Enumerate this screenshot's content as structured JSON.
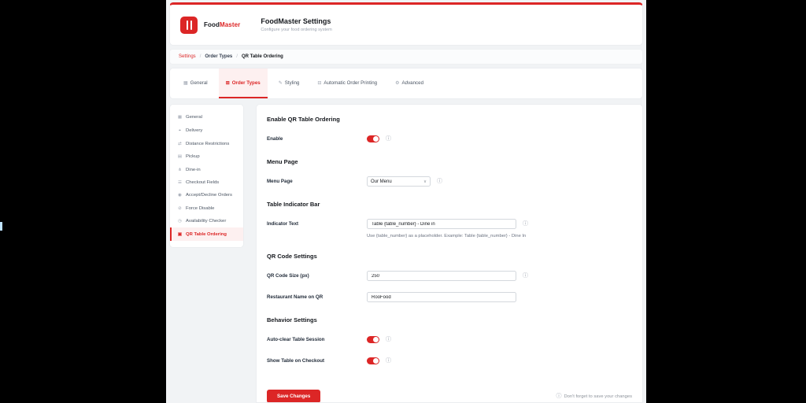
{
  "header": {
    "brand_primary": "Food",
    "brand_secondary": "Master",
    "title": "FoodMaster Settings",
    "subtitle": "Configure your food ordering system"
  },
  "breadcrumb": {
    "settings": "Settings",
    "sep": "/",
    "order_types": "Order Types",
    "current": "QR Table Ordering"
  },
  "tabs": {
    "items": [
      {
        "label": "General",
        "glyph": "▦",
        "active": false
      },
      {
        "label": "Order Types",
        "glyph": "⊞",
        "active": true
      },
      {
        "label": "Styling",
        "glyph": "✎",
        "active": false
      },
      {
        "label": "Automatic Order Printing",
        "glyph": "⊟",
        "active": false
      },
      {
        "label": "Advanced",
        "glyph": "⚙",
        "active": false
      }
    ]
  },
  "sidebar": {
    "items": [
      {
        "label": "General",
        "glyph": "▦",
        "active": false
      },
      {
        "label": "Delivery",
        "glyph": "⌖",
        "active": false
      },
      {
        "label": "Distance Restrictions",
        "glyph": "⇄",
        "active": false
      },
      {
        "label": "Pickup",
        "glyph": "▤",
        "active": false
      },
      {
        "label": "Dine-in",
        "glyph": "⋔",
        "active": false
      },
      {
        "label": "Checkout Fields",
        "glyph": "☰",
        "active": false
      },
      {
        "label": "Accept/Decline Orders",
        "glyph": "◉",
        "active": false
      },
      {
        "label": "Force Disable",
        "glyph": "⊘",
        "active": false
      },
      {
        "label": "Availability Checker",
        "glyph": "◷",
        "active": false
      },
      {
        "label": "QR Table Ordering",
        "glyph": "▣",
        "active": true
      }
    ]
  },
  "icons": {
    "info": "ⓘ",
    "chevron_down": "∨"
  },
  "main": {
    "sections": [
      {
        "title": "Enable QR Table Ordering"
      },
      {
        "title": "Menu Page"
      },
      {
        "title": "Table Indicator Bar"
      },
      {
        "title": "QR Code Settings"
      },
      {
        "title": "Behavior Settings"
      }
    ],
    "fields": {
      "enable": {
        "label": "Enable",
        "state": "on"
      },
      "menu_page": {
        "label": "Menu Page",
        "value": "Our Menu"
      },
      "indicator_text": {
        "label": "Indicator Text",
        "value": "Table {table_number} - Dine in",
        "helper": "Use {table_number} as a placeholder. Example: Table {table_number} - Dine In"
      },
      "qr_size": {
        "label": "QR Code Size (px)",
        "value": "250"
      },
      "restaurant_name": {
        "label": "Restaurant Name on QR",
        "value": "RooFood"
      },
      "auto_clear": {
        "label": "Auto-clear Table Session",
        "state": "on"
      },
      "show_table": {
        "label": "Show Table on Checkout",
        "state": "on"
      }
    },
    "footer": {
      "save_label": "Save Changes",
      "note": "Don't forget to save your changes"
    }
  }
}
